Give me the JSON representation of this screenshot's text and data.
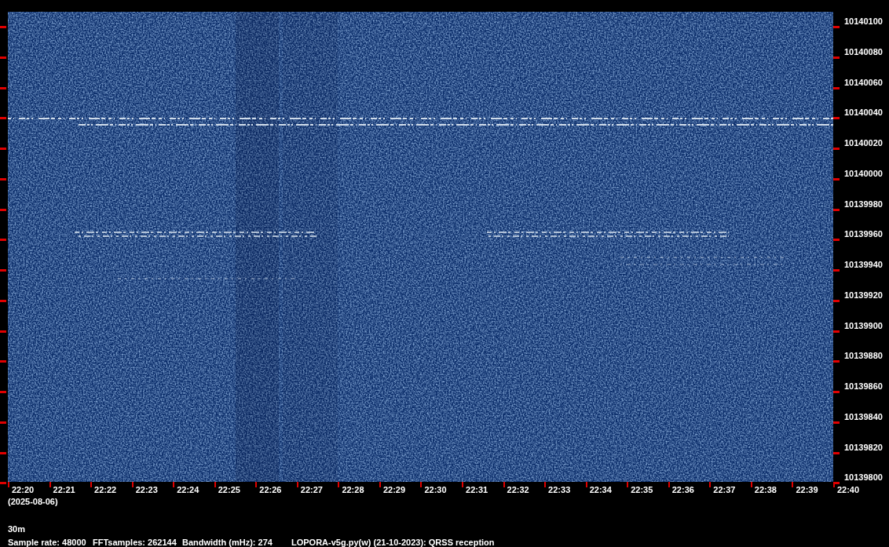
{
  "frequency_axis": {
    "labels": [
      "10140100",
      "10140080",
      "10140060",
      "10140040",
      "10140020",
      "10140000",
      "10139980",
      "10139960",
      "10139940",
      "10139920",
      "10139900",
      "10139880",
      "10139860",
      "10139840",
      "10139820",
      "10139800"
    ]
  },
  "time_axis": {
    "labels": [
      "22:20",
      "22:21",
      "22:22",
      "22:23",
      "22:24",
      "22:25",
      "22:26",
      "22:27",
      "22:28",
      "22:29",
      "22:30",
      "22:31",
      "22:32",
      "22:33",
      "22:34",
      "22:35",
      "22:36",
      "22:37",
      "22:38",
      "22:39",
      "22:40"
    ],
    "date": "(2025-08-06)"
  },
  "band": "30m",
  "status": {
    "sample_rate": "Sample rate: 48000",
    "fft_samples": "FFTsamples: 262144",
    "bandwidth": "Bandwidth (mHz): 274",
    "program": "LOPORA-v5g.py(w) (21-10-2023): QRSS reception"
  }
}
